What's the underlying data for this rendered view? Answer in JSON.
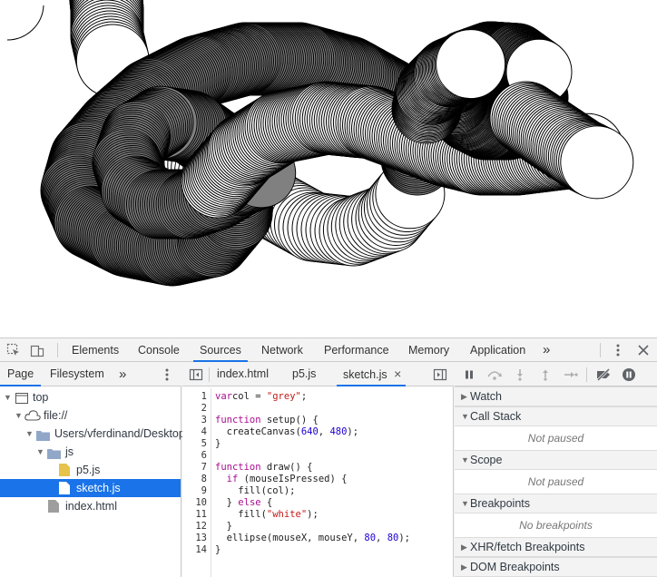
{
  "sketch": {
    "fill_grey": "#808080",
    "fill_white": "#ffffff",
    "stroke": "#000000",
    "ellipse_size": 80,
    "canvas_size": [
      640,
      480
    ]
  },
  "devtools": {
    "tabs": [
      "Elements",
      "Console",
      "Sources",
      "Network",
      "Performance",
      "Memory",
      "Application"
    ],
    "active_tab": "Sources",
    "more_tabs": "»",
    "navigator": {
      "tabs": [
        "Page",
        "Filesystem"
      ],
      "more": "»",
      "tree": [
        {
          "label": "top"
        },
        {
          "label": "file://"
        },
        {
          "label": "Users/vferdinand/Desktop"
        },
        {
          "label": "js"
        },
        {
          "label": "p5.js"
        },
        {
          "label": "sketch.js",
          "selected": true
        },
        {
          "label": "index.html"
        }
      ]
    },
    "editor": {
      "tabs": [
        "index.html",
        "p5.js",
        "sketch.js"
      ],
      "active_tab": "sketch.js",
      "close": "×",
      "line_numbers": [
        "1",
        "2",
        "3",
        "4",
        "5",
        "6",
        "7",
        "8",
        "9",
        "10",
        "11",
        "12",
        "13",
        "14"
      ]
    },
    "debugger": {
      "sections": [
        {
          "title": "Watch",
          "body": ""
        },
        {
          "title": "Call Stack",
          "body": "Not paused"
        },
        {
          "title": "Scope",
          "body": "Not paused"
        },
        {
          "title": "Breakpoints",
          "body": "No breakpoints"
        },
        {
          "title": "XHR/fetch Breakpoints",
          "body": ""
        },
        {
          "title": "DOM Breakpoints",
          "body": ""
        }
      ]
    },
    "colors": {
      "accent": "#1a73e8",
      "keyword": "#aa0d91",
      "string": "#c41a16",
      "number": "#1c00cf"
    }
  }
}
